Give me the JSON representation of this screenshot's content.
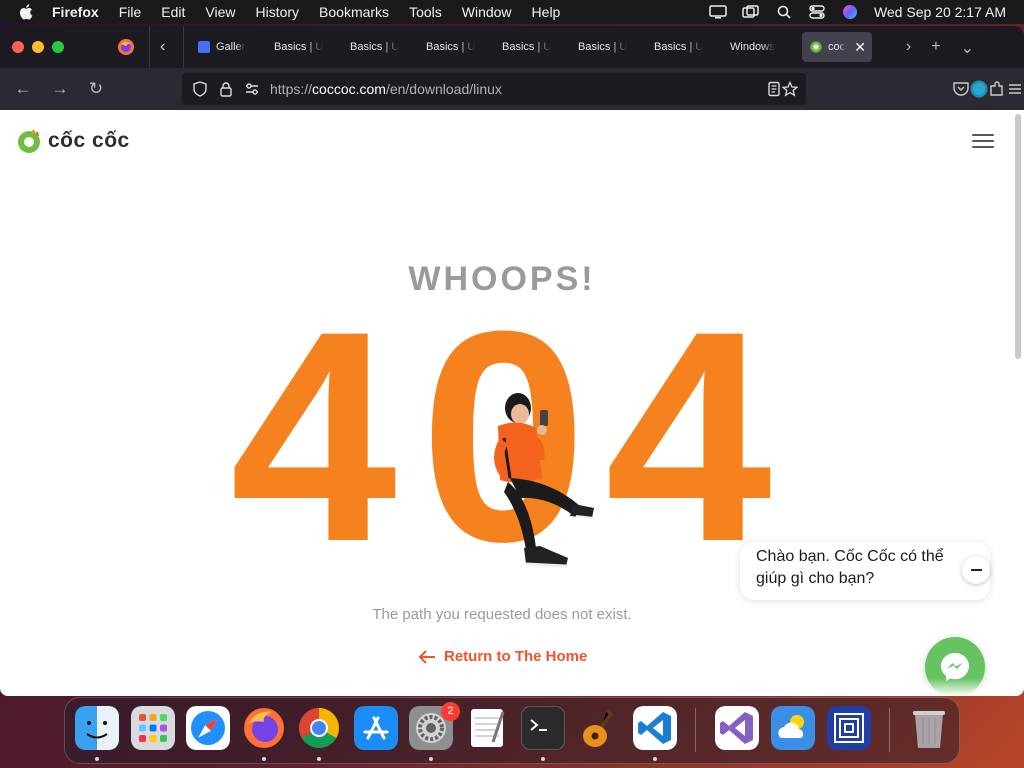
{
  "menubar": {
    "app_name": "Firefox",
    "items": [
      "File",
      "Edit",
      "View",
      "History",
      "Bookmarks",
      "Tools",
      "Window",
      "Help"
    ],
    "clock": "Wed Sep 20  2:17 AM"
  },
  "tabs": [
    {
      "label": "Galler",
      "favicon_color": "#4a6cf7"
    },
    {
      "label": "Basics | U"
    },
    {
      "label": "Basics | U"
    },
    {
      "label": "Basics | U"
    },
    {
      "label": "Basics | U"
    },
    {
      "label": "Basics | U"
    },
    {
      "label": "Basics | U"
    },
    {
      "label": "Windows"
    },
    {
      "label": "coc",
      "active": true
    }
  ],
  "url": {
    "prefix": "https://",
    "host": "coccoc.com",
    "path": "/en/download/linux"
  },
  "page": {
    "logo_text": "cốc cốc",
    "heading": "WHOOPS!",
    "code_digits": [
      "4",
      "0",
      "4"
    ],
    "message": "The path you requested does not exist.",
    "home_link": "Return to The Home",
    "accent_color": "#f5821f",
    "link_color": "#f0542a"
  },
  "chat": {
    "greeting_line1": "Chào bạn. Cốc Cốc có thể",
    "greeting_line2": "giúp gì cho bạn?"
  },
  "dock": {
    "apps": [
      "Finder",
      "Launchpad",
      "Safari",
      "Firefox",
      "Chrome",
      "App Store",
      "System Settings",
      "TextEdit",
      "Terminal",
      "GarageBand",
      "Visual Studio Code",
      "Visual Studio",
      "Weather",
      "Simulator",
      "Trash"
    ],
    "settings_badge": "2"
  }
}
